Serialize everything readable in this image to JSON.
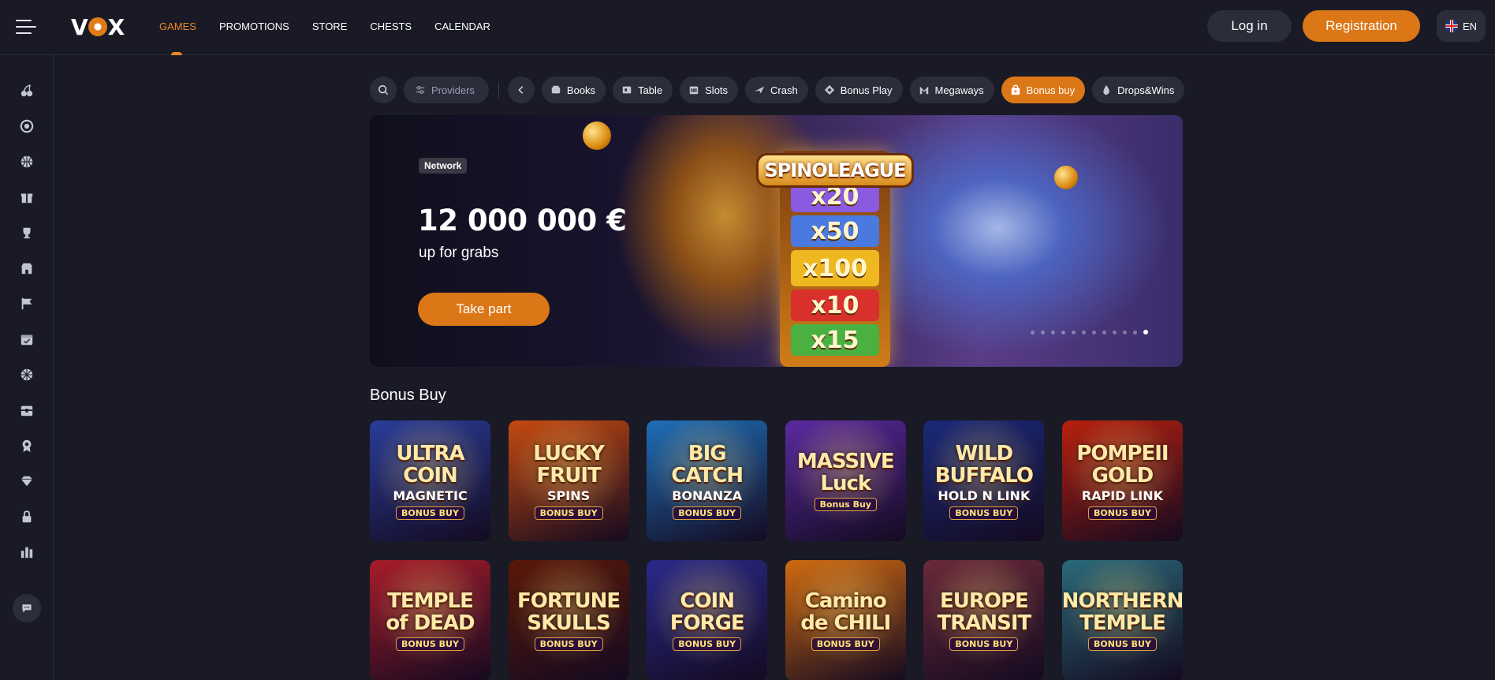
{
  "header": {
    "logo": "VOX",
    "nav": [
      "GAMES",
      "PROMOTIONS",
      "STORE",
      "CHESTS",
      "CALENDAR"
    ],
    "active_nav": "GAMES",
    "login_label": "Log in",
    "register_label": "Registration",
    "language": "EN"
  },
  "sidebar": {
    "icons": [
      "cherries-icon",
      "chip-icon",
      "basketball-icon",
      "gift-icon",
      "trophy-icon",
      "store-icon",
      "flag-icon",
      "calendar-icon",
      "wheel-icon",
      "chest-icon",
      "badge-icon",
      "diamond-icon",
      "lock-icon",
      "leaderboard-icon"
    ],
    "chat_icon": "chat-icon"
  },
  "filters": {
    "providers_label": "Providers",
    "categories": [
      {
        "label": "Books",
        "icon": "book-icon"
      },
      {
        "label": "Table",
        "icon": "table-icon"
      },
      {
        "label": "Slots",
        "icon": "slots-icon"
      },
      {
        "label": "Crash",
        "icon": "plane-icon"
      },
      {
        "label": "Bonus Play",
        "icon": "bonus-play-icon"
      },
      {
        "label": "Megaways",
        "icon": "megaways-icon"
      },
      {
        "label": "Bonus buy",
        "icon": "bag-icon"
      },
      {
        "label": "Drops&Wins",
        "icon": "drop-icon"
      }
    ],
    "active": "Bonus buy"
  },
  "banner": {
    "badge": "Network",
    "amount": "12 000 000 €",
    "subtitle": "up for grabs",
    "cta": "Take part",
    "art_title": "SPINOLEAGUE",
    "multipliers": [
      "x20",
      "x50",
      "x100",
      "x10",
      "x15"
    ],
    "slides_total": 12,
    "active_slide": 12
  },
  "games": {
    "section_title": "Bonus Buy",
    "items": [
      {
        "title": "ULTRA COIN",
        "sub": "MAGNETIC",
        "tag": "BONUS BUY",
        "bg": "#2a3d9a"
      },
      {
        "title": "LUCKY FRUIT",
        "sub": "SPINS",
        "tag": "BONUS BUY",
        "bg": "#c54a10"
      },
      {
        "title": "BIG CATCH",
        "sub": "BONANZA",
        "tag": "BONUS BUY",
        "bg": "#1f6fb8"
      },
      {
        "title": "MASSIVE Luck",
        "sub": "",
        "tag": "Bonus Buy",
        "bg": "#5a2aa0"
      },
      {
        "title": "WILD BUFFALO",
        "sub": "HOLD N LINK",
        "tag": "BONUS BUY",
        "bg": "#1a2a7a"
      },
      {
        "title": "POMPEII GOLD",
        "sub": "RAPID LINK",
        "tag": "BONUS BUY",
        "bg": "#b8200e"
      },
      {
        "title": "TEMPLE of DEAD",
        "sub": "",
        "tag": "BONUS BUY",
        "bg": "#a81c2a"
      },
      {
        "title": "FORTUNE SKULLS",
        "sub": "",
        "tag": "BONUS BUY",
        "bg": "#5a1808"
      },
      {
        "title": "COIN FORGE",
        "sub": "",
        "tag": "BONUS BUY",
        "bg": "#2a2a8a"
      },
      {
        "title": "Camino de CHILI",
        "sub": "",
        "tag": "BONUS BUY",
        "bg": "#d06a10"
      },
      {
        "title": "EUROPE TRANSIT",
        "sub": "",
        "tag": "BONUS BUY",
        "bg": "#6a2a3a"
      },
      {
        "title": "NORTHERN TEMPLE",
        "sub": "",
        "tag": "BONUS BUY",
        "bg": "#2a6a7a"
      }
    ]
  },
  "colors": {
    "background": "#191a26",
    "accent": "#dc7717",
    "chip": "#2b2d3b",
    "muted_text": "#9b9daf"
  }
}
